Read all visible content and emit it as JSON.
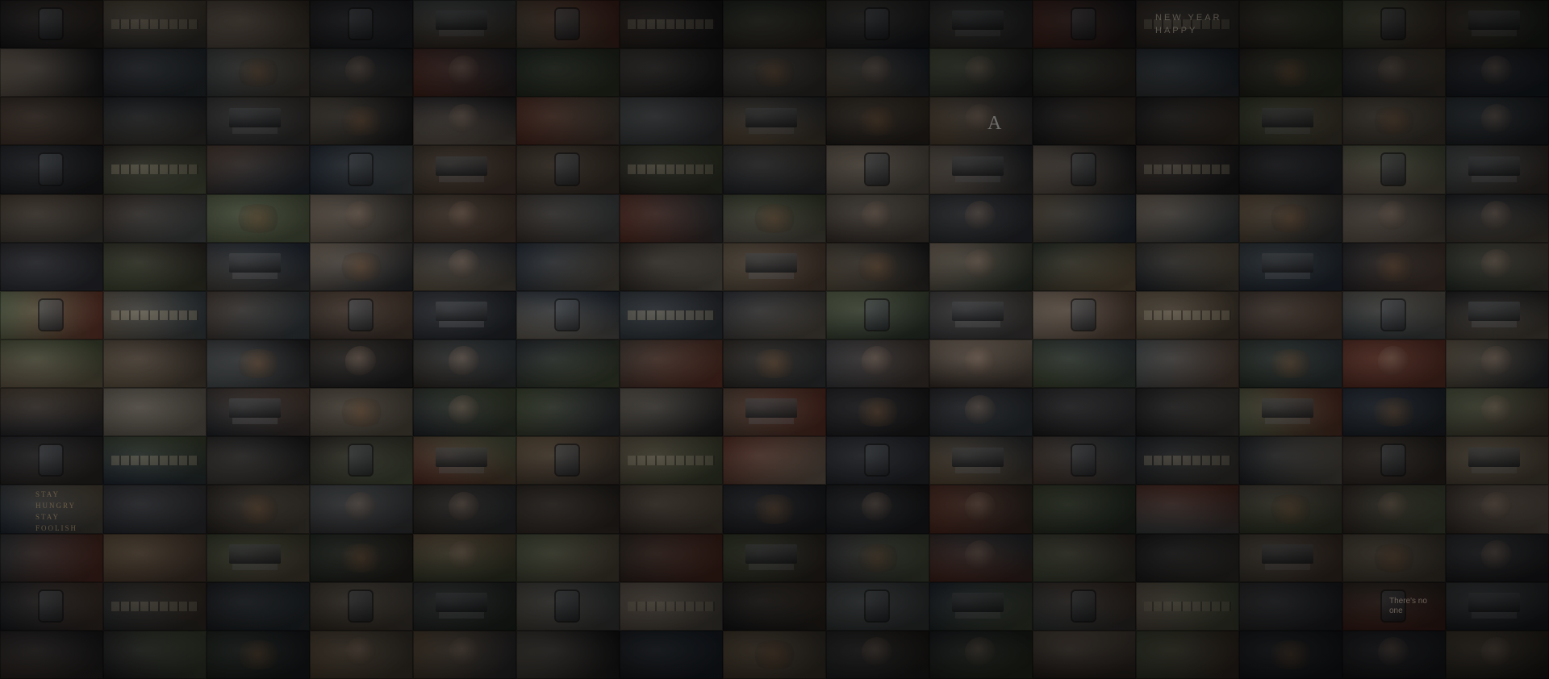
{
  "background": {
    "kind": "photo-mosaic",
    "columns": 15,
    "rows": 14,
    "base_color": "#0c0c0e",
    "overlay_color": "#000000"
  },
  "visible_text": {
    "tile_new_year_happy": "NEW YEAR HAPPY",
    "tile_stay_hungry": "STAY HUNGRY STAY FOOLISH",
    "tile_letter_a": "A",
    "tile_no_one": "There's no one"
  },
  "palette": [
    "#3a332c",
    "#5a4a3a",
    "#2a3038",
    "#6d6252",
    "#404448",
    "#7a6a52",
    "#2e2e34",
    "#4d5a3a",
    "#6b5040",
    "#373b44",
    "#555049",
    "#262629",
    "#7d7466",
    "#4a3c33",
    "#3e4a52",
    "#5c6466",
    "#813c2c",
    "#2c3a4c",
    "#6b7a55",
    "#8a6f4e",
    "#4b4b50",
    "#9a8672",
    "#334033",
    "#52443b"
  ],
  "tile_icons": [
    "device",
    "laptop",
    "face",
    "scrabble",
    "food",
    "plain",
    "plain",
    "face",
    "plain",
    "device",
    "plain",
    "food",
    "laptop",
    "plain",
    "face"
  ]
}
